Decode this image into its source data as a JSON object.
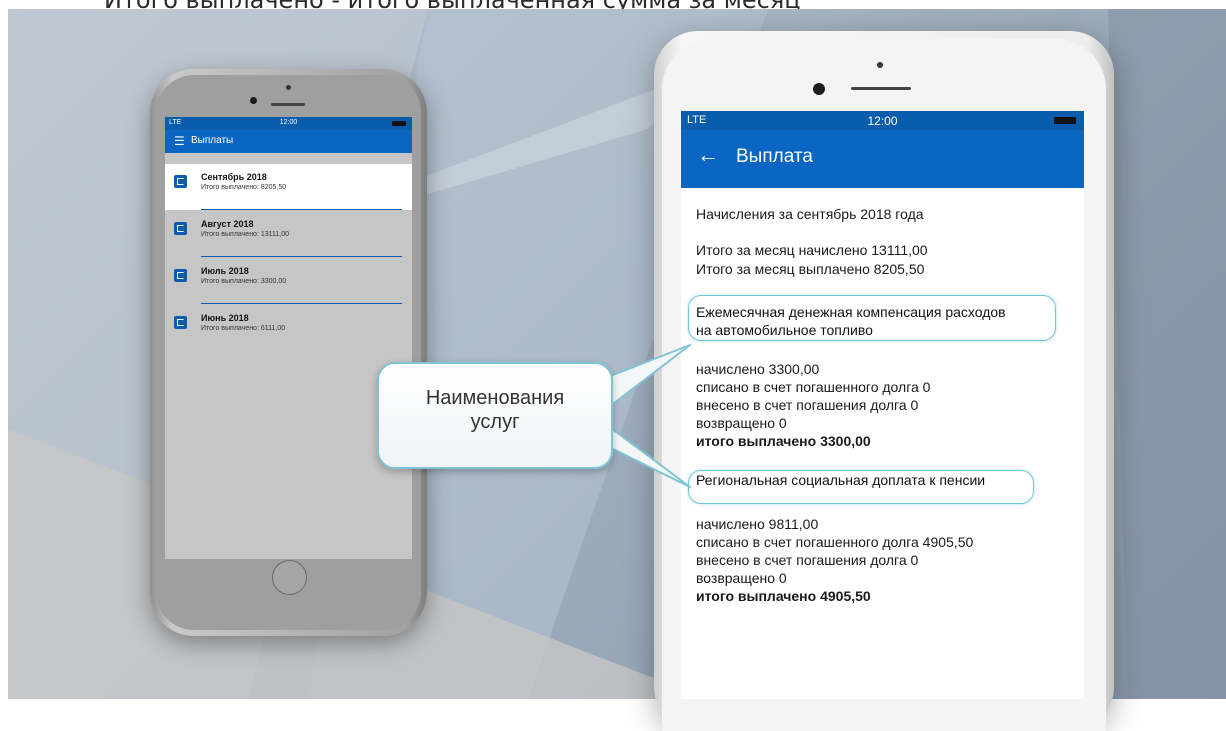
{
  "caption": "Итого выплачено - итого выплаченная сумма за месяц",
  "left_phone": {
    "status": {
      "signal": "LTE",
      "time": "12:00"
    },
    "app_title": "Выплаты",
    "menu_icon": "hamburger-icon",
    "payments": [
      {
        "title": "Сентябрь 2018",
        "subtitle": "Итого выплачено: 8205,50",
        "selected": true
      },
      {
        "title": "Август 2018",
        "subtitle": "Итого выплачено: 13111,00",
        "selected": false
      },
      {
        "title": "Июль 2018",
        "subtitle": "Итого выплачено: 3300,00",
        "selected": false
      },
      {
        "title": "Июнь 2018",
        "subtitle": "Итого выплачено: 6111,00",
        "selected": false
      }
    ]
  },
  "right_phone": {
    "status": {
      "signal": "LTE",
      "time": "12:00"
    },
    "back_icon": "back-arrow-icon",
    "app_title": "Выплата",
    "detail": {
      "heading": "Начисления за сентябрь 2018 года",
      "total_accrued": "Итого за месяц начислено 13111,00",
      "total_paid": "Итого за месяц выплачено 8205,50",
      "services": [
        {
          "name_line1": "Ежемесячная денежная компенсация расходов",
          "name_line2": "на автомобильное топливо",
          "accrued": "начислено 3300,00",
          "written_off": "списано в счет погашенного долга 0",
          "deposited": "внесено в счет погашения долга 0",
          "returned": "возвращено 0",
          "total": "итого выплачено 3300,00"
        },
        {
          "name_line1": "Региональная социальная доплата к пенсии",
          "accrued": "начислено 9811,00",
          "written_off": "списано в счет погашенного долга 4905,50",
          "deposited": "внесено в счет погашения долга 0",
          "returned": "возвращено 0",
          "total": "итого выплачено 4905,50"
        }
      ]
    }
  },
  "callout": {
    "line1": "Наименования",
    "line2": "услуг"
  },
  "colors": {
    "app_bar": "#0a66c2",
    "status_bar": "#0a5cac",
    "highlight": "#6ec7d6"
  }
}
